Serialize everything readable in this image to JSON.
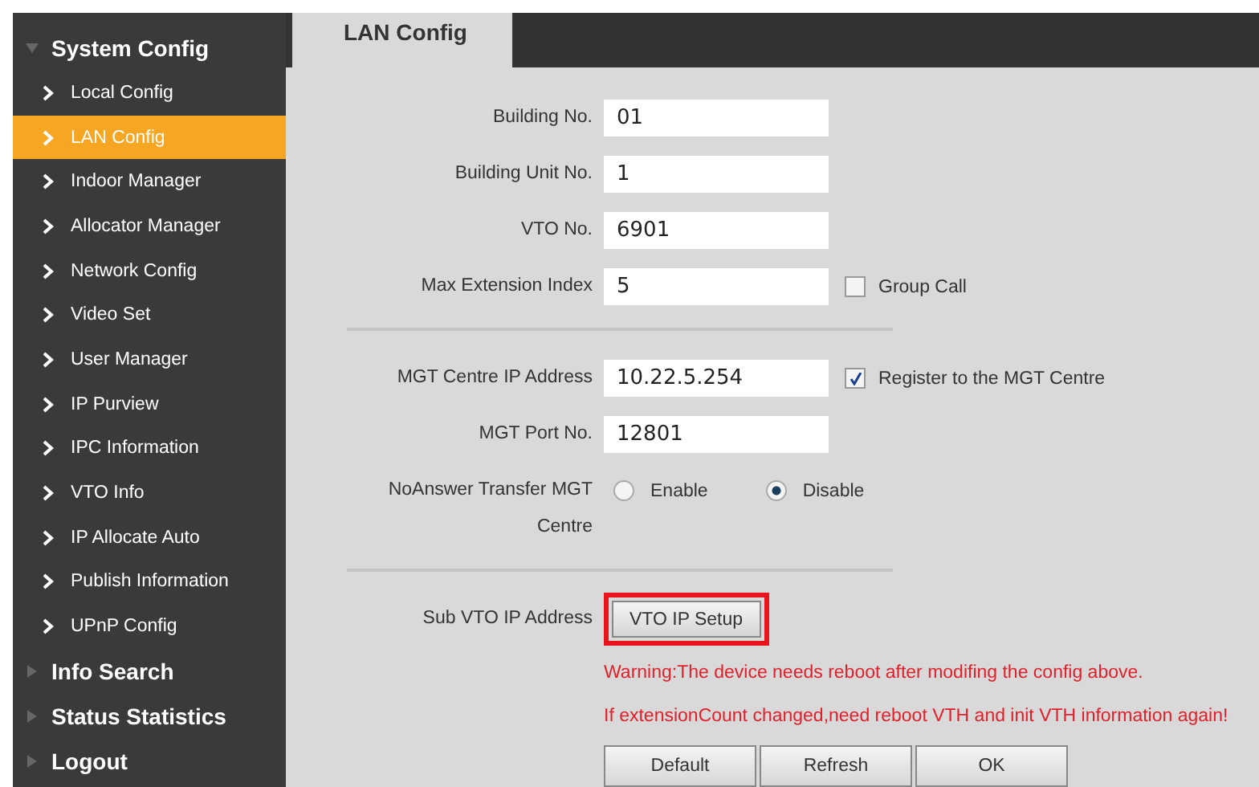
{
  "sidebar": {
    "sections": [
      {
        "label": "System Config",
        "expanded": true,
        "items": [
          {
            "label": "Local Config",
            "selected": false
          },
          {
            "label": "LAN Config",
            "selected": true
          },
          {
            "label": "Indoor Manager",
            "selected": false
          },
          {
            "label": "Allocator Manager",
            "selected": false
          },
          {
            "label": "Network Config",
            "selected": false
          },
          {
            "label": "Video Set",
            "selected": false
          },
          {
            "label": "User Manager",
            "selected": false
          },
          {
            "label": "IP Purview",
            "selected": false
          },
          {
            "label": "IPC Information",
            "selected": false
          },
          {
            "label": "VTO Info",
            "selected": false
          },
          {
            "label": "IP Allocate Auto",
            "selected": false
          },
          {
            "label": "Publish Information",
            "selected": false
          },
          {
            "label": "UPnP Config",
            "selected": false
          }
        ]
      },
      {
        "label": "Info Search",
        "expanded": false
      },
      {
        "label": "Status Statistics",
        "expanded": false
      },
      {
        "label": "Logout",
        "expanded": false
      }
    ]
  },
  "tab": {
    "label": "LAN Config"
  },
  "groups": [
    {
      "rows": [
        {
          "kind": "field",
          "label": "Building No.",
          "value": "01"
        },
        {
          "kind": "field",
          "label": "Building Unit No.",
          "value": "1"
        },
        {
          "kind": "field",
          "label": "VTO No.",
          "value": "6901"
        },
        {
          "kind": "field",
          "label": "Max Extension Index",
          "value": "5",
          "checkbox": {
            "label": "Group Call",
            "checked": false
          }
        }
      ]
    },
    {
      "rows": [
        {
          "kind": "field",
          "label": "MGT Centre IP Address",
          "value": "10.22.5.254",
          "checkbox": {
            "label": "Register to the MGT Centre",
            "checked": true
          }
        },
        {
          "kind": "field",
          "label": "MGT Port No.",
          "value": "12801"
        },
        {
          "kind": "radio",
          "label": [
            "NoAnswer Transfer MGT",
            "Centre"
          ],
          "options": [
            {
              "label": "Enable",
              "selected": false
            },
            {
              "label": "Disable",
              "selected": true
            }
          ]
        }
      ]
    },
    {
      "rows": [
        {
          "kind": "button",
          "label": "Sub VTO IP Address",
          "button": "VTO IP Setup",
          "highlighted": true
        }
      ]
    }
  ],
  "warnings": [
    "Warning:The device needs reboot after modifing the config above.",
    "If extensionCount changed,need reboot VTH and init VTH information again!"
  ],
  "buttons": [
    "Default",
    "Refresh",
    "OK"
  ]
}
